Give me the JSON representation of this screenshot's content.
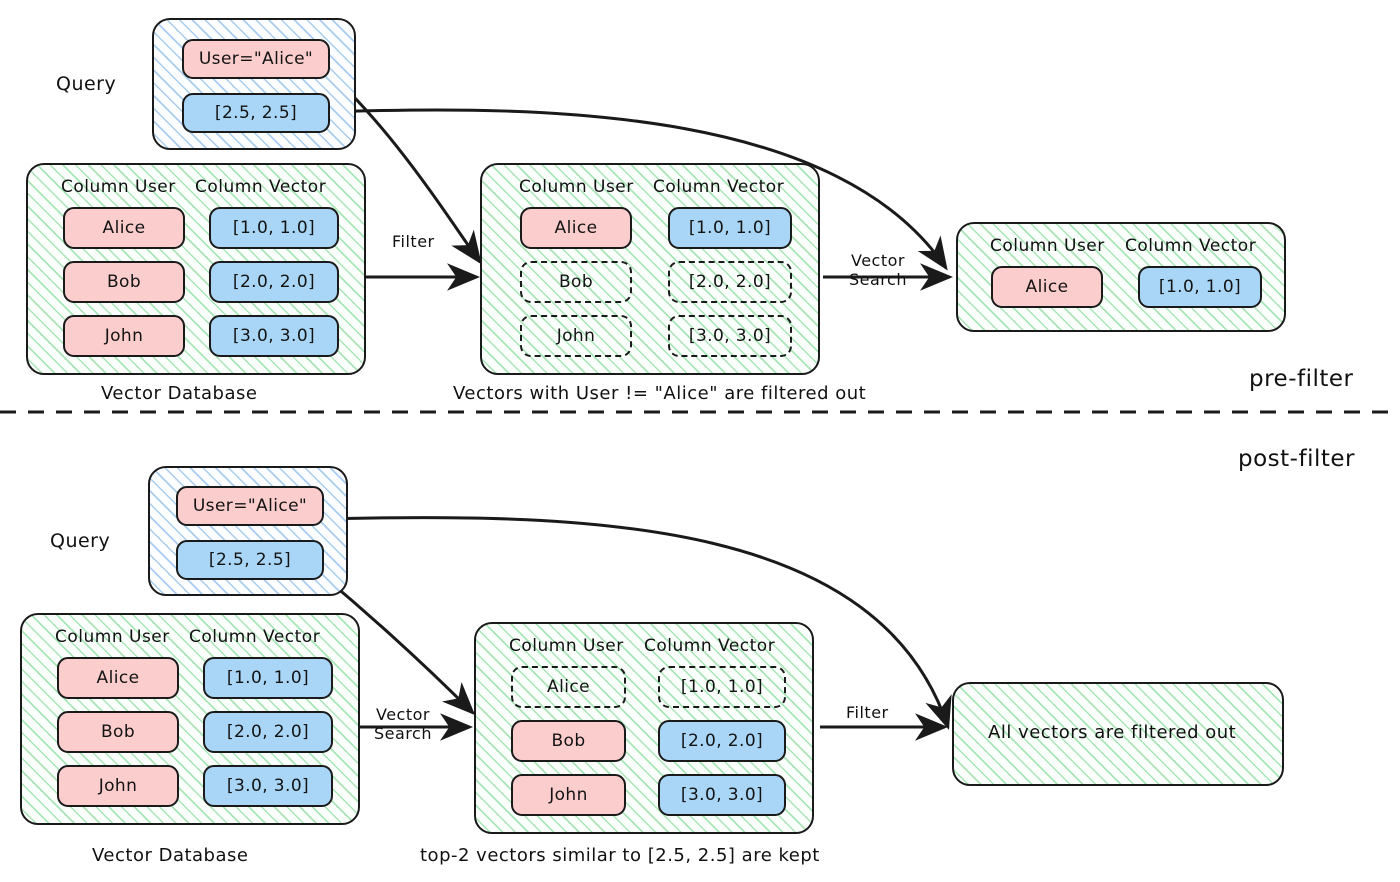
{
  "diagram": {
    "title_absent": true,
    "phases": [
      {
        "id": "pre",
        "label": "pre-filter"
      },
      {
        "id": "post",
        "label": "post-filter"
      }
    ],
    "colors": {
      "user_cell": "#fbcdcd",
      "vector_cell": "#a9d6f6",
      "panel_hatch_green": "#a8e6b8",
      "panel_hatch_blue": "#a9cdf0",
      "stroke": "#1a1a1a",
      "cross_out": "#b52020"
    },
    "column_headers": {
      "user": "Column User",
      "vector": "Column Vector"
    }
  },
  "pre_filter": {
    "query": {
      "side_label": "Query",
      "filter_value": "User=\"Alice\"",
      "vector_value": "[2.5, 2.5]"
    },
    "database": {
      "caption": "Vector Database",
      "header_user": "Column User",
      "header_vector": "Column Vector",
      "rows": [
        {
          "user": "Alice",
          "vector": "[1.0, 1.0]",
          "removed": false
        },
        {
          "user": "Bob",
          "vector": "[2.0, 2.0]",
          "removed": false
        },
        {
          "user": "John",
          "vector": "[3.0, 3.0]",
          "removed": false
        }
      ]
    },
    "arrow_filter_label": "Filter",
    "filtered": {
      "caption": "Vectors with User != \"Alice\" are filtered out",
      "header_user": "Column User",
      "header_vector": "Column Vector",
      "rows": [
        {
          "user": "Alice",
          "vector": "[1.0, 1.0]",
          "removed": false
        },
        {
          "user": "Bob",
          "vector": "[2.0, 2.0]",
          "removed": true
        },
        {
          "user": "John",
          "vector": "[3.0, 3.0]",
          "removed": true
        }
      ]
    },
    "arrow_search_label": "Vector\nSearch",
    "arrow_search_line1": "Vector",
    "arrow_search_line2": "Search",
    "result": {
      "header_user": "Column User",
      "header_vector": "Column Vector",
      "rows": [
        {
          "user": "Alice",
          "vector": "[1.0, 1.0]",
          "removed": false
        }
      ]
    }
  },
  "post_filter": {
    "query": {
      "side_label": "Query",
      "filter_value": "User=\"Alice\"",
      "vector_value": "[2.5, 2.5]"
    },
    "database": {
      "caption": "Vector Database",
      "header_user": "Column User",
      "header_vector": "Column Vector",
      "rows": [
        {
          "user": "Alice",
          "vector": "[1.0, 1.0]",
          "removed": false
        },
        {
          "user": "Bob",
          "vector": "[2.0, 2.0]",
          "removed": false
        },
        {
          "user": "John",
          "vector": "[3.0, 3.0]",
          "removed": false
        }
      ]
    },
    "arrow_search_line1": "Vector",
    "arrow_search_line2": "Search",
    "searched": {
      "caption": "top-2 vectors similar to [2.5, 2.5] are kept",
      "header_user": "Column User",
      "header_vector": "Column Vector",
      "rows": [
        {
          "user": "Alice",
          "vector": "[1.0, 1.0]",
          "removed": true
        },
        {
          "user": "Bob",
          "vector": "[2.0, 2.0]",
          "removed": false
        },
        {
          "user": "John",
          "vector": "[3.0, 3.0]",
          "removed": false
        }
      ]
    },
    "arrow_filter_label": "Filter",
    "result": {
      "message": "All vectors are filtered out"
    }
  }
}
